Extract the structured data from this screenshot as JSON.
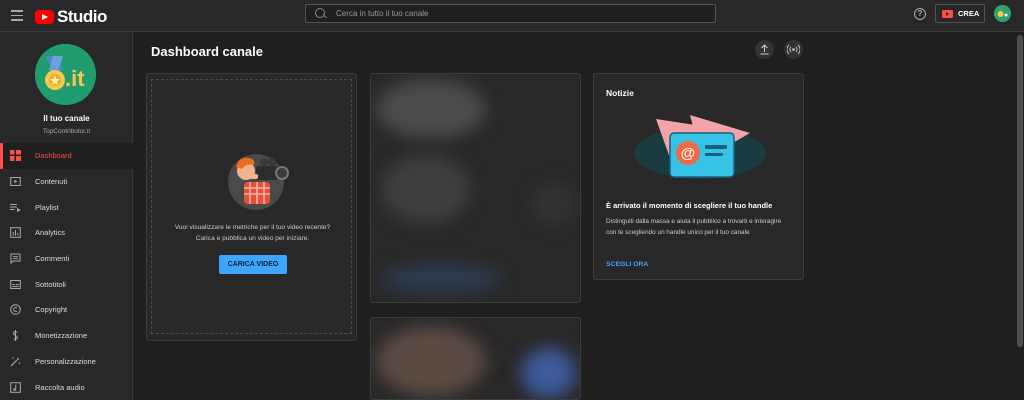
{
  "app": {
    "title": "Studio"
  },
  "search": {
    "placeholder": "Cerca in tutto il tuo canale"
  },
  "header": {
    "help_label": "?",
    "create_label": "CREA"
  },
  "channel": {
    "name": "Il tuo canale",
    "handle": "TopContributor.it",
    "logo_text": ".it"
  },
  "sidebar": {
    "items": [
      {
        "label": "Dashboard",
        "icon": "dashboard-icon",
        "active": true
      },
      {
        "label": "Contenuti",
        "icon": "content-icon"
      },
      {
        "label": "Playlist",
        "icon": "playlist-icon"
      },
      {
        "label": "Analytics",
        "icon": "analytics-icon"
      },
      {
        "label": "Commenti",
        "icon": "comments-icon"
      },
      {
        "label": "Sottotitoli",
        "icon": "subtitles-icon"
      },
      {
        "label": "Copyright",
        "icon": "copyright-icon"
      },
      {
        "label": "Monetizzazione",
        "icon": "monetization-icon"
      },
      {
        "label": "Personalizzazione",
        "icon": "customization-icon"
      },
      {
        "label": "Raccolta audio",
        "icon": "audio-library-icon"
      }
    ]
  },
  "main": {
    "title": "Dashboard canale",
    "upload_card": {
      "line1": "Vuoi visualizzare le metriche per il tuo video recente?",
      "line2": "Carica e pubblica un video per iniziare.",
      "button": "CARICA VIDEO"
    },
    "news": {
      "title": "Notizie",
      "heading": "È arrivato il momento di scegliere il tuo handle",
      "body": "Distinguiti dalla massa e aiuta il pubblico a trovarti e interagire con te scegliendo un handle unico per il tuo canale",
      "link": "SCEGLI ORA"
    }
  },
  "colors": {
    "accent": "#ff4e45",
    "link": "#3ea6ff",
    "background": "#1f1f1f",
    "surface": "#282828"
  }
}
